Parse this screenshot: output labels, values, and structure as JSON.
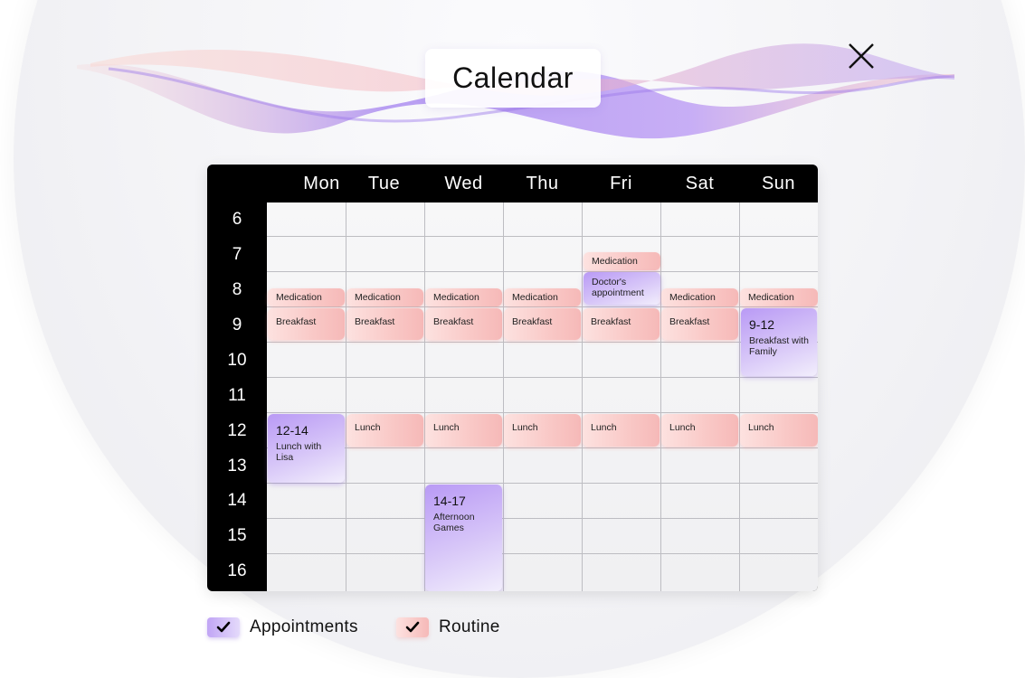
{
  "title": "Calendar",
  "icons": {
    "close": "close-icon",
    "check": "check-icon"
  },
  "colors": {
    "appointment": "#b99af5",
    "routine": "#f9c8c6",
    "header_bg": "#000000"
  },
  "days": [
    "Mon",
    "Tue",
    "Wed",
    "Thu",
    "Fri",
    "Sat",
    "Sun"
  ],
  "hours": [
    "6",
    "7",
    "8",
    "9",
    "10",
    "11",
    "12",
    "13",
    "14",
    "15",
    "16"
  ],
  "events": {
    "fri_medication_7": "Medication",
    "fri_doctor": "Doctor's appointment",
    "mon_medication": "Medication",
    "tue_medication": "Medication",
    "wed_medication": "Medication",
    "thu_medication": "Medication",
    "sat_medication": "Medication",
    "sun_medication": "Medication",
    "mon_breakfast": "Breakfast",
    "tue_breakfast": "Breakfast",
    "wed_breakfast": "Breakfast",
    "thu_breakfast": "Breakfast",
    "fri_breakfast": "Breakfast",
    "sat_breakfast": "Breakfast",
    "sun_family_time": "9-12",
    "sun_family_desc": "Breakfast with Family",
    "mon_lisa_time": "12-14",
    "mon_lisa_desc": "Lunch with Lisa",
    "tue_lunch": "Lunch",
    "wed_lunch": "Lunch",
    "thu_lunch": "Lunch",
    "fri_lunch": "Lunch",
    "sat_lunch": "Lunch",
    "sun_lunch": "Lunch",
    "wed_games_time": "14-17",
    "wed_games_desc": "Afternoon Games"
  },
  "legend": {
    "appointments": "Appointments",
    "routine": "Routine"
  }
}
